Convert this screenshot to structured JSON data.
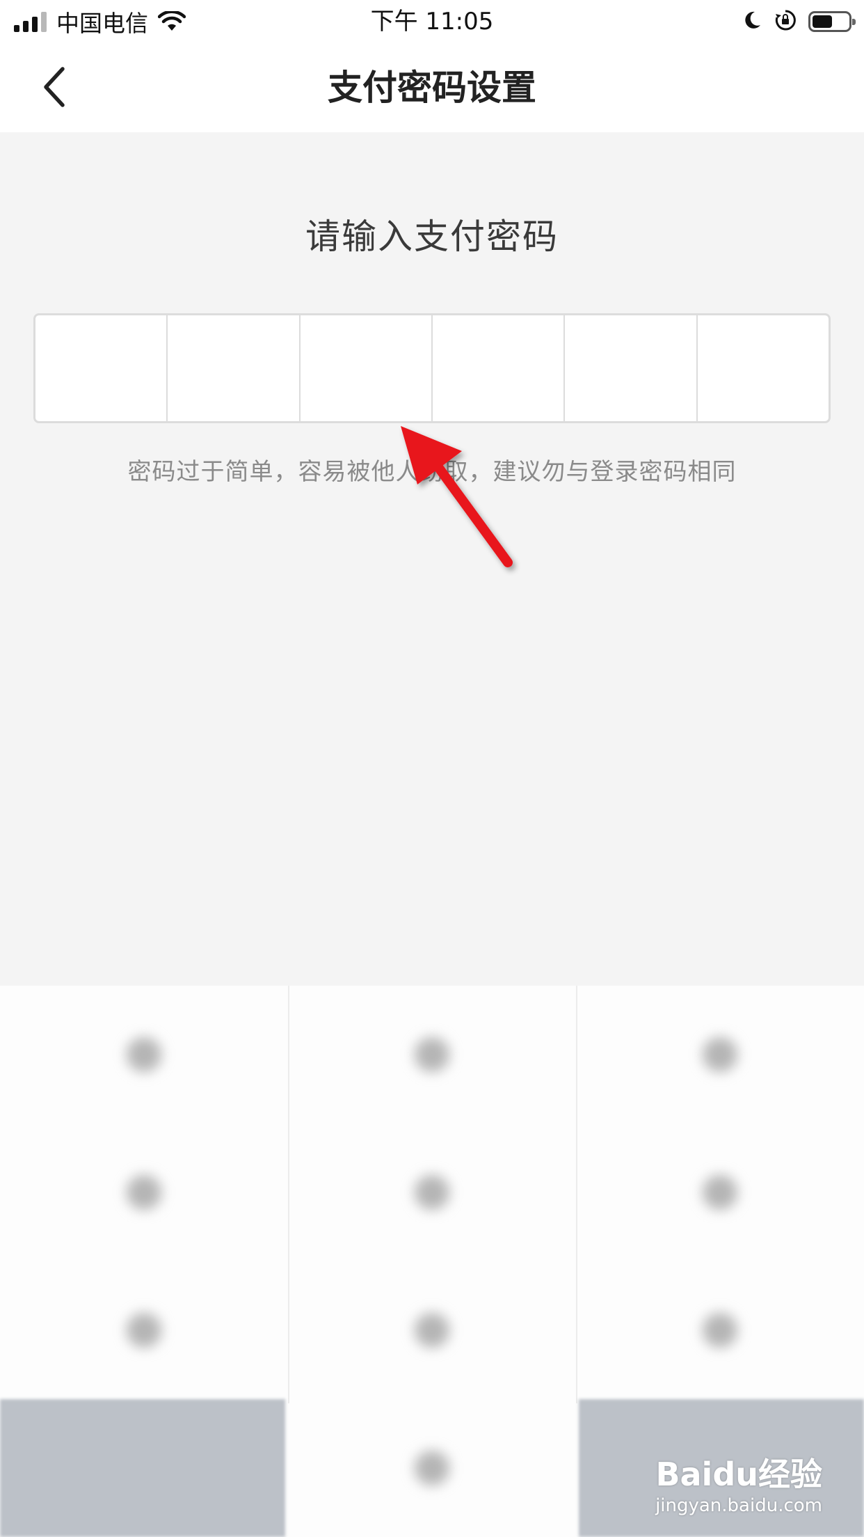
{
  "status_bar": {
    "carrier": "中国电信",
    "time": "下午 11:05"
  },
  "nav": {
    "title": "支付密码设置",
    "back_icon": "chevron-left-icon"
  },
  "content": {
    "prompt": "请输入支付密码",
    "pin_length": 6,
    "hint": "密码过于简单，容易被他人窃取，建议勿与登录密码相同"
  },
  "annotation": {
    "arrow_color": "#e8141b"
  },
  "watermark": {
    "logo": "Baidu经验",
    "url": "jingyan.baidu.com"
  },
  "colors": {
    "page_bg": "#f4f4f4",
    "keypad_func_bg": "#bcc1c8"
  }
}
